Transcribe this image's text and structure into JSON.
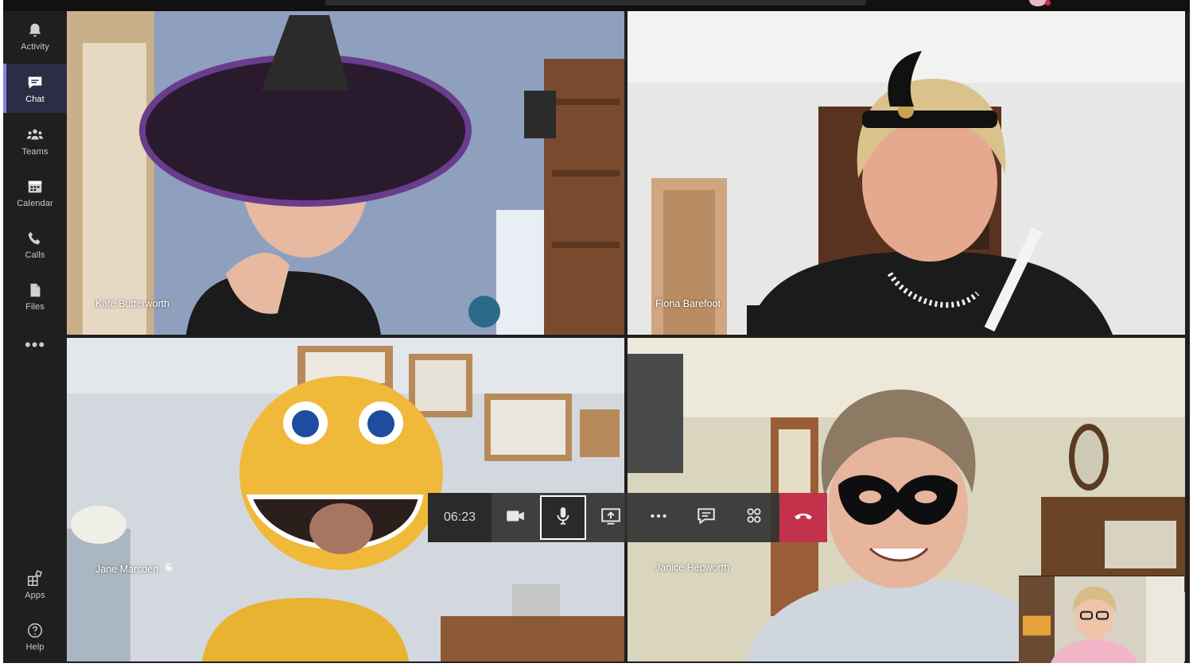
{
  "rail": {
    "items": [
      {
        "label": "Activity",
        "icon": "bell-icon"
      },
      {
        "label": "Chat",
        "icon": "chat-icon"
      },
      {
        "label": "Teams",
        "icon": "teams-icon"
      },
      {
        "label": "Calendar",
        "icon": "calendar-icon"
      },
      {
        "label": "Calls",
        "icon": "phone-icon"
      },
      {
        "label": "Files",
        "icon": "file-icon"
      }
    ],
    "more": "•••",
    "apps_label": "Apps",
    "help_label": "Help",
    "active_item": "Chat"
  },
  "participants": [
    {
      "name": "Kate Butterworth"
    },
    {
      "name": "Fiona Barefoot"
    },
    {
      "name": "Jane Marsden",
      "muted": true
    },
    {
      "name": "Janice Hepworth"
    }
  ],
  "controls": {
    "timer": "06:23",
    "buttons": [
      "camera-icon",
      "microphone-icon",
      "share-screen-icon",
      "more-options-icon",
      "conversation-icon",
      "participants-icon",
      "hang-up-icon"
    ]
  },
  "colors": {
    "accent": "#7b83eb",
    "hangup": "#c4314b",
    "rail_bg": "#1f1f1f"
  }
}
